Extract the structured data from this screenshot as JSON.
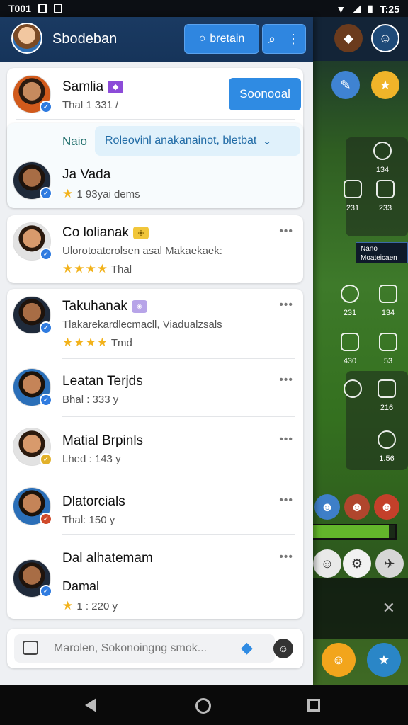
{
  "status": {
    "time_left": "T001",
    "icons_left": [
      "sim-icon",
      "lock-icon"
    ],
    "time_right": "T:25"
  },
  "header": {
    "title": "Sbodeban",
    "button_label": "bretain"
  },
  "featured": {
    "name": "Samlia",
    "sub": "Thal 1 331 /",
    "action_label": "Soonooal",
    "chip_label": "Naio",
    "dropdown_label": "Roleovinl anakanainot, bletbat",
    "second_name": "Ja Vada",
    "second_sub": "1 93yai dems"
  },
  "posts": [
    {
      "name": "Co lolianak",
      "text": "Ulorotoatcrolsen asal Makaekaek:",
      "stars": "★★★★",
      "meta": "Thal"
    },
    {
      "name": "Takuhanak",
      "text": "Tlakarekardlecmacll, Viadualzsals",
      "stars": "★★★★",
      "meta": "Tmd"
    }
  ],
  "people": [
    {
      "name": "Leatan Terjds",
      "sub": "Bhal : 333 y"
    },
    {
      "name": "Matial Brpinls",
      "sub": "Lhed : 143 y"
    },
    {
      "name": "Dlatorcials",
      "sub": "Thal: 150 y"
    },
    {
      "name": "Dal alhatemam",
      "sub2": "Damal",
      "sub": "1 : 220 y"
    }
  ],
  "composer": {
    "placeholder": "Marolen, Sokonoingng smok..."
  },
  "game": {
    "labels": [
      "134",
      "231",
      "233",
      "231",
      "134",
      "430",
      "53",
      "216",
      "1.56"
    ],
    "tooltip": "Nano Moateicaen",
    "progress": 0.92
  },
  "colors": {
    "header": "#1a3a62",
    "accent": "#2f8be3",
    "star": "#f2b21b"
  }
}
